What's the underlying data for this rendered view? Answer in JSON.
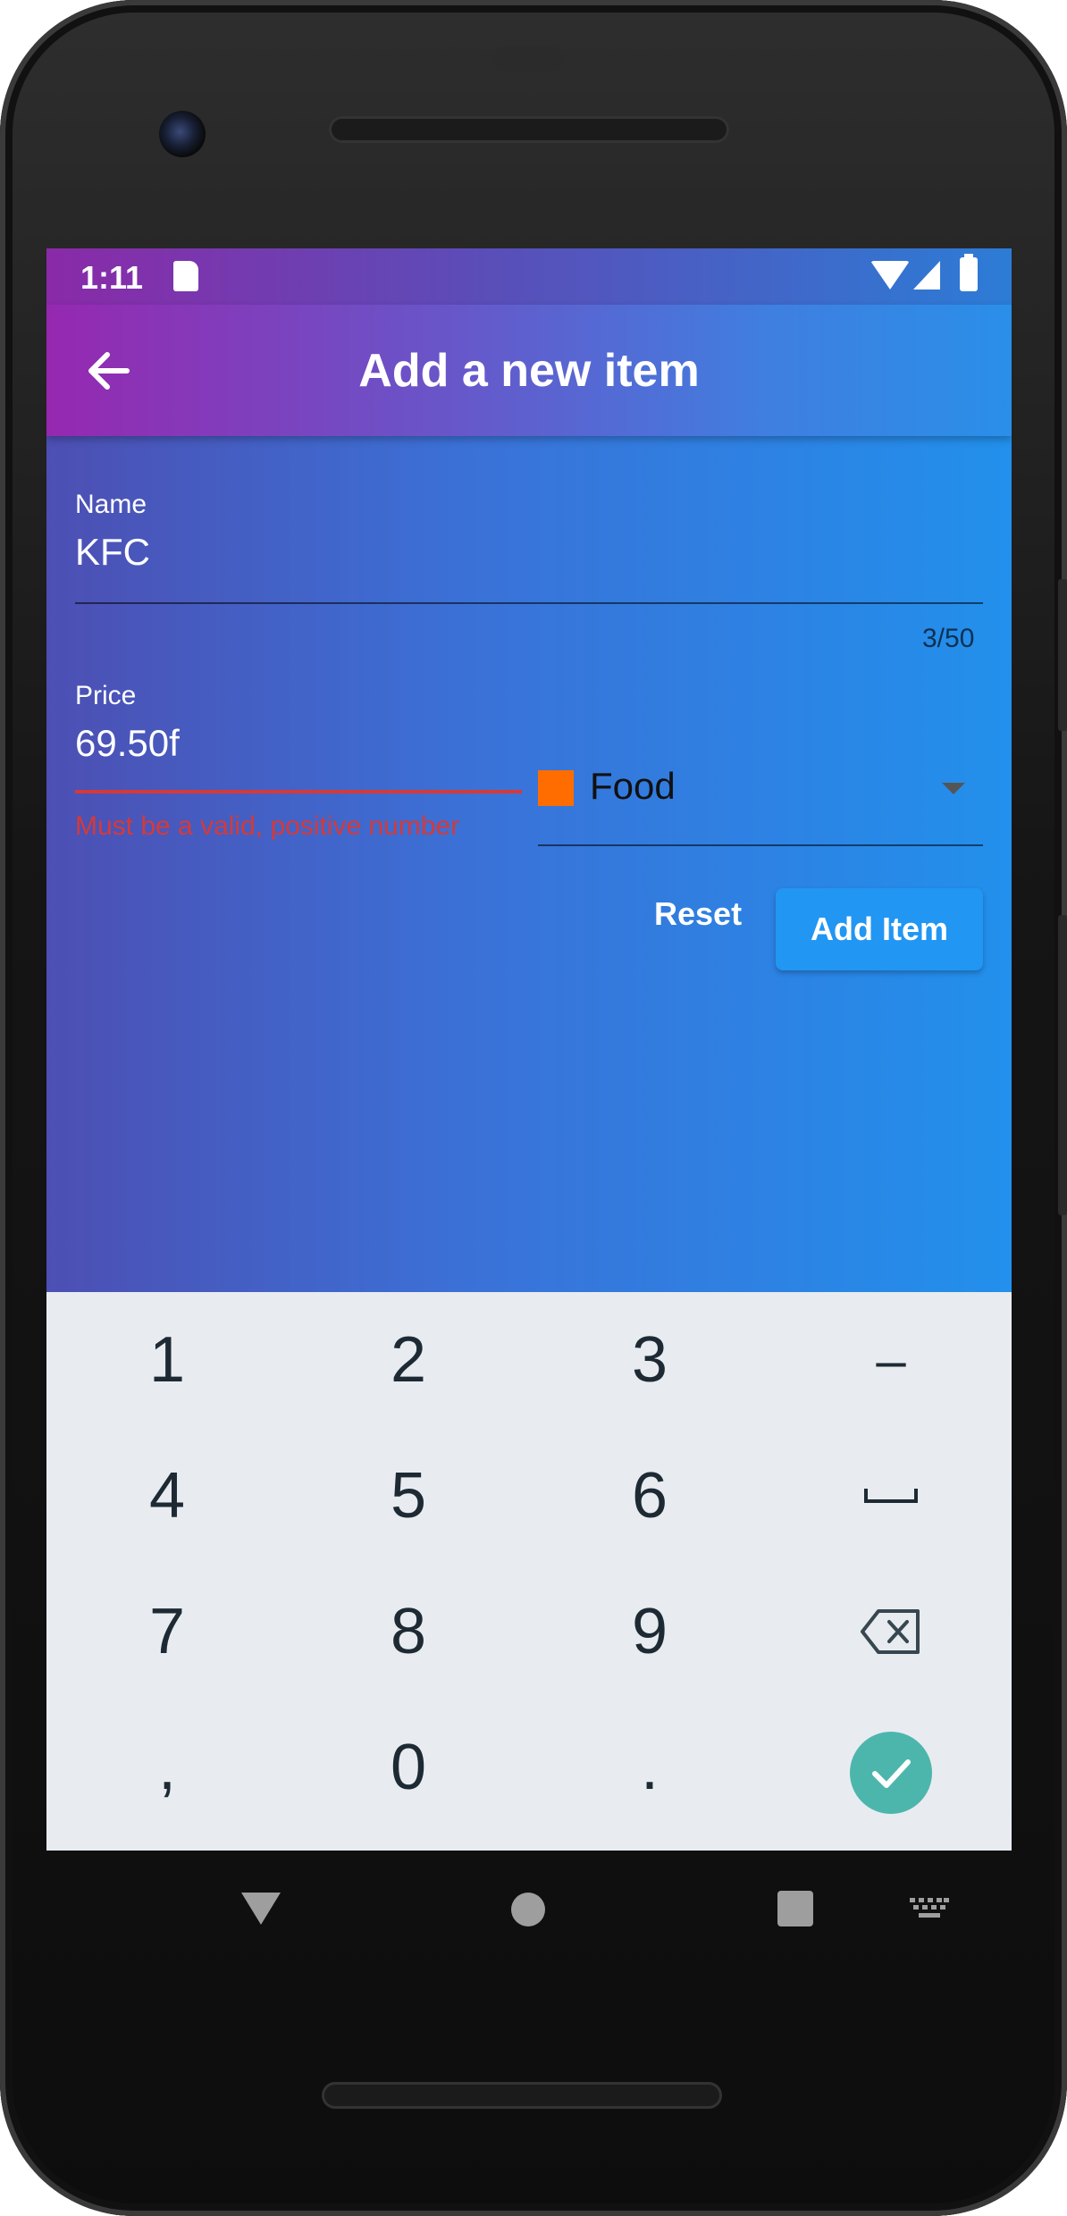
{
  "status_bar": {
    "time": "1:11"
  },
  "app_bar": {
    "title": "Add a new item",
    "back_icon": "arrow-back-icon"
  },
  "form": {
    "name_field": {
      "label": "Name",
      "value": "KFC",
      "counter": "3/50"
    },
    "price_field": {
      "label": "Price",
      "value": "69.50f",
      "error": "Must be a valid, positive number"
    },
    "category_dropdown": {
      "selected": "Food",
      "swatch_color": "#ff6d00"
    },
    "reset_label": "Reset",
    "add_item_label": "Add Item"
  },
  "keyboard": {
    "rows": [
      [
        "1",
        "2",
        "3",
        "–"
      ],
      [
        "4",
        "5",
        "6",
        "space-icon"
      ],
      [
        "7",
        "8",
        "9",
        "backspace-icon"
      ],
      [
        ",",
        "0",
        ".",
        "check-icon"
      ]
    ],
    "enter_color": "#4db6ac"
  },
  "colors": {
    "error": "#d43a3a",
    "primary_button": "#2196f3"
  }
}
